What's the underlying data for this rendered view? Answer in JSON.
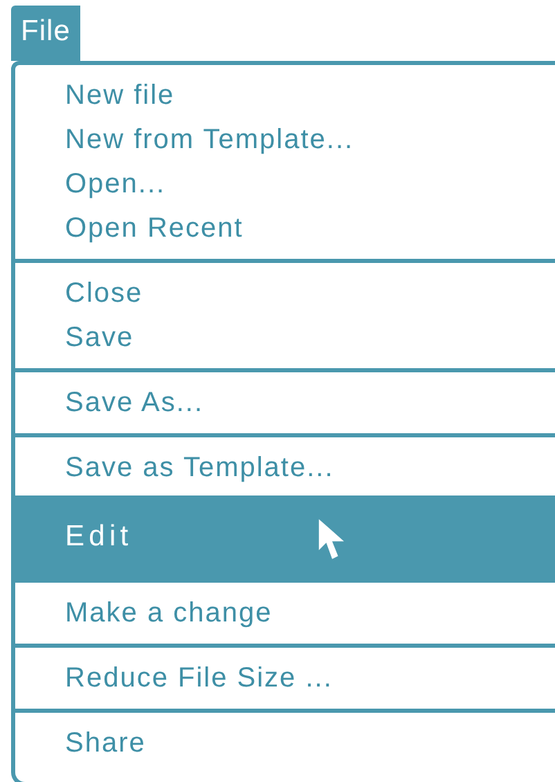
{
  "menu_title": {
    "label": "File",
    "selected": true
  },
  "groups": [
    {
      "items": [
        {
          "label": "New file",
          "selected": false
        },
        {
          "label": "New from Template...",
          "selected": false
        },
        {
          "label": "Open...",
          "selected": false
        },
        {
          "label": "Open Recent",
          "selected": false
        }
      ]
    },
    {
      "items": [
        {
          "label": "Close",
          "selected": false
        },
        {
          "label": "Save",
          "selected": false
        }
      ]
    },
    {
      "items": [
        {
          "label": "Save As...",
          "selected": false
        }
      ]
    },
    {
      "items": [
        {
          "label": "Save as Template...",
          "selected": false
        },
        {
          "label": "Edit",
          "selected": true
        }
      ]
    },
    {
      "items": [
        {
          "label": "Make a change",
          "selected": false
        }
      ]
    },
    {
      "items": [
        {
          "label": "Reduce File Size ...",
          "selected": false
        }
      ]
    },
    {
      "items": [
        {
          "label": "Share",
          "selected": false
        }
      ]
    }
  ]
}
